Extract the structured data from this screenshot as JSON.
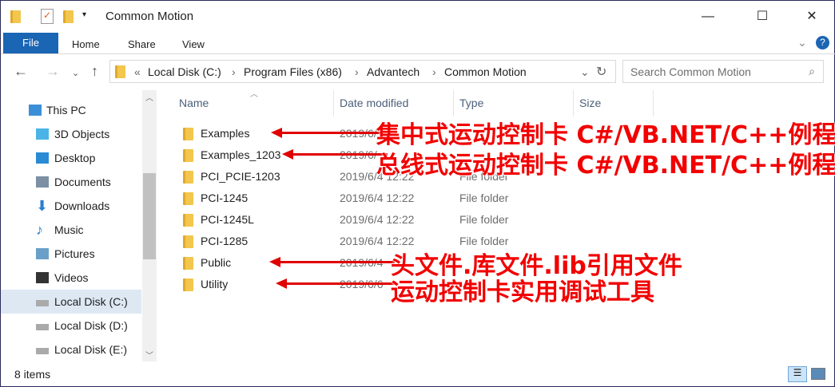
{
  "window": {
    "title": "Common Motion",
    "minimize": "—",
    "maximize": "☐",
    "close": "✕"
  },
  "ribbon": {
    "tabs": [
      "File",
      "Home",
      "Share",
      "View"
    ]
  },
  "address": {
    "path": [
      "«",
      "Local Disk (C:)",
      "Program Files (x86)",
      "Advantech",
      "Common Motion"
    ],
    "separator": "›",
    "search_placeholder": "Search Common Motion"
  },
  "sidebar": {
    "items": [
      {
        "label": "This PC",
        "icon": "computer-icon"
      },
      {
        "label": "3D Objects",
        "icon": "cube-icon"
      },
      {
        "label": "Desktop",
        "icon": "desktop-icon"
      },
      {
        "label": "Documents",
        "icon": "documents-icon"
      },
      {
        "label": "Downloads",
        "icon": "download-icon"
      },
      {
        "label": "Music",
        "icon": "music-icon"
      },
      {
        "label": "Pictures",
        "icon": "pictures-icon"
      },
      {
        "label": "Videos",
        "icon": "video-icon"
      },
      {
        "label": "Local Disk (C:)",
        "icon": "drive-icon",
        "selected": true
      },
      {
        "label": "Local Disk (D:)",
        "icon": "drive-icon"
      },
      {
        "label": "Local Disk (E:)",
        "icon": "drive-icon"
      }
    ]
  },
  "columns": {
    "name": "Name",
    "date": "Date modified",
    "type": "Type",
    "size": "Size"
  },
  "files": [
    {
      "name": "Examples",
      "date": "2019/6/",
      "type": ""
    },
    {
      "name": "Examples_1203",
      "date": "2019/6/",
      "type": ""
    },
    {
      "name": "PCI_PCIE-1203",
      "date": "2019/6/4 12:22",
      "type": "File folder"
    },
    {
      "name": "PCI-1245",
      "date": "2019/6/4 12:22",
      "type": "File folder"
    },
    {
      "name": "PCI-1245L",
      "date": "2019/6/4 12:22",
      "type": "File folder"
    },
    {
      "name": "PCI-1285",
      "date": "2019/6/4 12:22",
      "type": "File folder"
    },
    {
      "name": "Public",
      "date": "2019/6/4",
      "type": ""
    },
    {
      "name": "Utility",
      "date": "2019/6/6",
      "type": ""
    }
  ],
  "annotations": [
    "集中式运动控制卡 C#/VB.NET/C++例程",
    "总线式运动控制卡 C#/VB.NET/C++例程",
    "头文件.库文件.lib引用文件",
    "运动控制卡实用调试工具"
  ],
  "status": {
    "count": "8 items"
  },
  "colors": {
    "accent": "#1a65b4",
    "annotation": "#f20000"
  }
}
